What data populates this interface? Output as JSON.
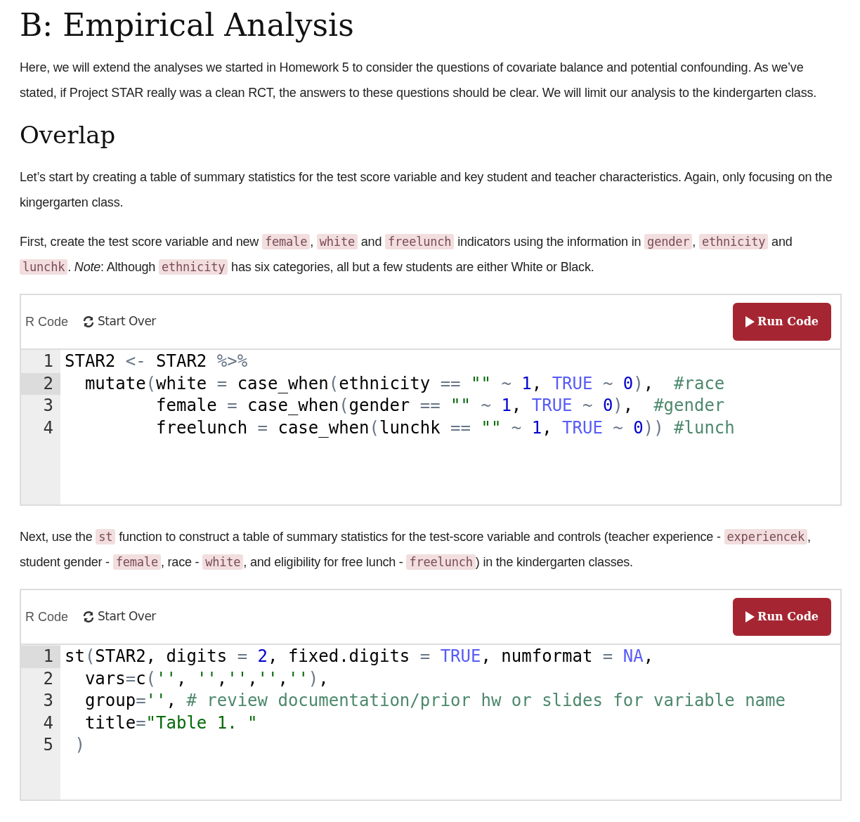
{
  "title": "B: Empirical Analysis",
  "blocks": [
    {
      "kind": "paragraph",
      "segments": [
        {
          "kind": "text",
          "text": "Here, we will extend the analyses we started in Homework 5 to consider the questions of covariate balance and potential confounding. As we’ve stated, if Project STAR really was a clean RCT, the answers to these questions should be clear. We will limit our analysis to the kindergarten class."
        }
      ]
    },
    {
      "kind": "heading",
      "text": "Overlap"
    },
    {
      "kind": "paragraph",
      "segments": [
        {
          "kind": "text",
          "text": "Let’s start by creating a table of summary statistics for the test score variable and key student and teacher characteristics. Again, only focusing on the kingergarten class."
        }
      ]
    },
    {
      "kind": "paragraph",
      "segments": [
        {
          "kind": "text",
          "text": "First, create the test score variable and new "
        },
        {
          "kind": "code",
          "text": "female"
        },
        {
          "kind": "text",
          "text": ", "
        },
        {
          "kind": "code",
          "text": "white"
        },
        {
          "kind": "text",
          "text": " and "
        },
        {
          "kind": "code",
          "text": "freelunch"
        },
        {
          "kind": "text",
          "text": " indicators using the information in "
        },
        {
          "kind": "code",
          "text": "gender"
        },
        {
          "kind": "text",
          "text": ", "
        },
        {
          "kind": "code",
          "text": "ethnicity"
        },
        {
          "kind": "text",
          "text": " and "
        },
        {
          "kind": "code",
          "text": "lunchk"
        },
        {
          "kind": "text",
          "text": ". *Note*: Although "
        },
        {
          "kind": "code",
          "text": "ethnicity"
        },
        {
          "kind": "text",
          "text": " has six categories, all but a few students are either White or Black."
        }
      ]
    },
    {
      "kind": "editor",
      "label": "R Code",
      "start_over": "Start Over",
      "run": "Run Code",
      "lines": [
        {
          "number": "1",
          "active": false,
          "tokens": [
            {
              "kind": "plain",
              "text": "STAR2 "
            },
            {
              "kind": "op",
              "text": "<- "
            },
            {
              "kind": "plain",
              "text": "STAR2 "
            },
            {
              "kind": "op",
              "text": "%>%"
            }
          ]
        },
        {
          "number": "2",
          "active": true,
          "tokens": [
            {
              "kind": "plain",
              "text": "  mutate"
            },
            {
              "kind": "op",
              "text": "("
            },
            {
              "kind": "plain",
              "text": "white "
            },
            {
              "kind": "op",
              "text": "= "
            },
            {
              "kind": "plain",
              "text": "case_when"
            },
            {
              "kind": "op",
              "text": "("
            },
            {
              "kind": "plain",
              "text": "ethnicity "
            },
            {
              "kind": "op",
              "text": "== "
            },
            {
              "kind": "string",
              "text": "\"\" "
            },
            {
              "kind": "op",
              "text": "~ "
            },
            {
              "kind": "number",
              "text": "1"
            },
            {
              "kind": "plain",
              "text": ", "
            },
            {
              "kind": "constant",
              "text": "TRUE "
            },
            {
              "kind": "op",
              "text": "~ "
            },
            {
              "kind": "number",
              "text": "0"
            },
            {
              "kind": "op",
              "text": ")"
            },
            {
              "kind": "plain",
              "text": ",  "
            },
            {
              "kind": "comment",
              "text": "#race"
            }
          ]
        },
        {
          "number": "3",
          "active": false,
          "tokens": [
            {
              "kind": "plain",
              "text": "         female "
            },
            {
              "kind": "op",
              "text": "= "
            },
            {
              "kind": "plain",
              "text": "case_when"
            },
            {
              "kind": "op",
              "text": "("
            },
            {
              "kind": "plain",
              "text": "gender "
            },
            {
              "kind": "op",
              "text": "== "
            },
            {
              "kind": "string",
              "text": "\"\" "
            },
            {
              "kind": "op",
              "text": "~ "
            },
            {
              "kind": "number",
              "text": "1"
            },
            {
              "kind": "plain",
              "text": ", "
            },
            {
              "kind": "constant",
              "text": "TRUE "
            },
            {
              "kind": "op",
              "text": "~ "
            },
            {
              "kind": "number",
              "text": "0"
            },
            {
              "kind": "op",
              "text": ")"
            },
            {
              "kind": "plain",
              "text": ",  "
            },
            {
              "kind": "comment",
              "text": "#gender"
            }
          ]
        },
        {
          "number": "4",
          "active": false,
          "tokens": [
            {
              "kind": "plain",
              "text": "         freelunch "
            },
            {
              "kind": "op",
              "text": "= "
            },
            {
              "kind": "plain",
              "text": "case_when"
            },
            {
              "kind": "op",
              "text": "("
            },
            {
              "kind": "plain",
              "text": "lunchk "
            },
            {
              "kind": "op",
              "text": "== "
            },
            {
              "kind": "string",
              "text": "\"\" "
            },
            {
              "kind": "op",
              "text": "~ "
            },
            {
              "kind": "number",
              "text": "1"
            },
            {
              "kind": "plain",
              "text": ", "
            },
            {
              "kind": "constant",
              "text": "TRUE "
            },
            {
              "kind": "op",
              "text": "~ "
            },
            {
              "kind": "number",
              "text": "0"
            },
            {
              "kind": "op",
              "text": ")) "
            },
            {
              "kind": "comment",
              "text": "#lunch"
            }
          ]
        }
      ]
    },
    {
      "kind": "paragraph",
      "segments": [
        {
          "kind": "text",
          "text": "Next, use the "
        },
        {
          "kind": "code",
          "text": "st"
        },
        {
          "kind": "text",
          "text": " function to construct a table of summary statistics for the test-score variable and controls (teacher experience - "
        },
        {
          "kind": "code",
          "text": "experiencek"
        },
        {
          "kind": "text",
          "text": ", student gender - "
        },
        {
          "kind": "code",
          "text": "female"
        },
        {
          "kind": "text",
          "text": ", race - "
        },
        {
          "kind": "code",
          "text": "white"
        },
        {
          "kind": "text",
          "text": ", and eligibility for free lunch - "
        },
        {
          "kind": "code",
          "text": "freelunch"
        },
        {
          "kind": "text",
          "text": ") in the kindergarten classes."
        }
      ]
    },
    {
      "kind": "editor",
      "label": "R Code",
      "start_over": "Start Over",
      "run": "Run Code",
      "lines": [
        {
          "number": "1",
          "active": true,
          "tokens": [
            {
              "kind": "plain",
              "text": "st"
            },
            {
              "kind": "op",
              "text": "("
            },
            {
              "kind": "plain",
              "text": "STAR2, digits "
            },
            {
              "kind": "op",
              "text": "= "
            },
            {
              "kind": "number",
              "text": "2"
            },
            {
              "kind": "plain",
              "text": ", fixed.digits "
            },
            {
              "kind": "op",
              "text": "= "
            },
            {
              "kind": "constant",
              "text": "TRUE"
            },
            {
              "kind": "plain",
              "text": ", numformat "
            },
            {
              "kind": "op",
              "text": "= "
            },
            {
              "kind": "constant",
              "text": "NA"
            },
            {
              "kind": "plain",
              "text": ","
            }
          ]
        },
        {
          "number": "2",
          "active": false,
          "tokens": [
            {
              "kind": "plain",
              "text": "  vars"
            },
            {
              "kind": "op",
              "text": "="
            },
            {
              "kind": "plain",
              "text": "c"
            },
            {
              "kind": "op",
              "text": "("
            },
            {
              "kind": "string",
              "text": "''"
            },
            {
              "kind": "plain",
              "text": ", "
            },
            {
              "kind": "string",
              "text": "''"
            },
            {
              "kind": "plain",
              "text": ","
            },
            {
              "kind": "string",
              "text": "''"
            },
            {
              "kind": "plain",
              "text": ","
            },
            {
              "kind": "string",
              "text": "''"
            },
            {
              "kind": "plain",
              "text": ","
            },
            {
              "kind": "string",
              "text": "''"
            },
            {
              "kind": "op",
              "text": ")"
            },
            {
              "kind": "plain",
              "text": ","
            }
          ]
        },
        {
          "number": "3",
          "active": false,
          "tokens": [
            {
              "kind": "plain",
              "text": "  group"
            },
            {
              "kind": "op",
              "text": "="
            },
            {
              "kind": "string",
              "text": "''"
            },
            {
              "kind": "plain",
              "text": ", "
            },
            {
              "kind": "comment",
              "text": "# review documentation/prior hw or slides for variable name"
            }
          ]
        },
        {
          "number": "4",
          "active": false,
          "tokens": [
            {
              "kind": "plain",
              "text": "  title"
            },
            {
              "kind": "op",
              "text": "="
            },
            {
              "kind": "string",
              "text": "\"Table 1. \""
            }
          ]
        },
        {
          "number": "5",
          "active": false,
          "tokens": [
            {
              "kind": "op",
              "text": " )"
            }
          ]
        }
      ]
    }
  ]
}
